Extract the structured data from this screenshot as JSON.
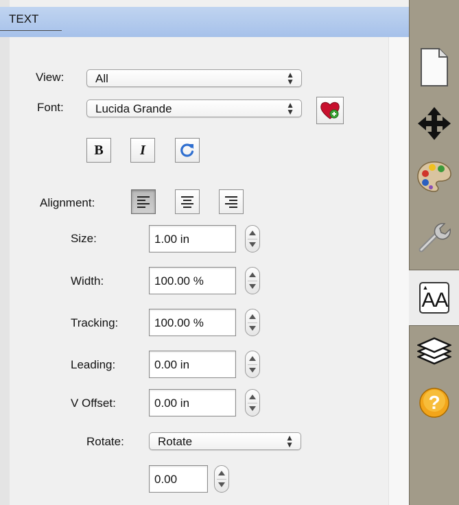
{
  "panel": {
    "title": "TEXT"
  },
  "view": {
    "label": "View:",
    "value": "All"
  },
  "font": {
    "label": "Font:",
    "value": "Lucida Grande"
  },
  "style_buttons": {
    "bold": "B",
    "italic": "I"
  },
  "alignment": {
    "label": "Alignment:",
    "selected": "left"
  },
  "fields": {
    "size": {
      "label": "Size:",
      "value": "1.00 in"
    },
    "width": {
      "label": "Width:",
      "value": "100.00 %"
    },
    "tracking": {
      "label": "Tracking:",
      "value": "100.00 %"
    },
    "leading": {
      "label": "Leading:",
      "value": "0.00 in"
    },
    "voffset": {
      "label": "V Offset:",
      "value": "0.00 in"
    }
  },
  "rotate": {
    "label": "Rotate:",
    "mode": "Rotate",
    "value": "0.00"
  },
  "toolbar": {
    "items": [
      "page-icon",
      "move-icon",
      "palette-icon",
      "wrench-icon",
      "text-size-icon",
      "layers-icon",
      "help-icon"
    ],
    "active": "text-size-icon",
    "text_icon_label": "AA"
  },
  "colors": {
    "title_bar": "#a6c1ea",
    "toolbar_bg": "#a29b89",
    "accent_blue": "#2f6fd0"
  }
}
